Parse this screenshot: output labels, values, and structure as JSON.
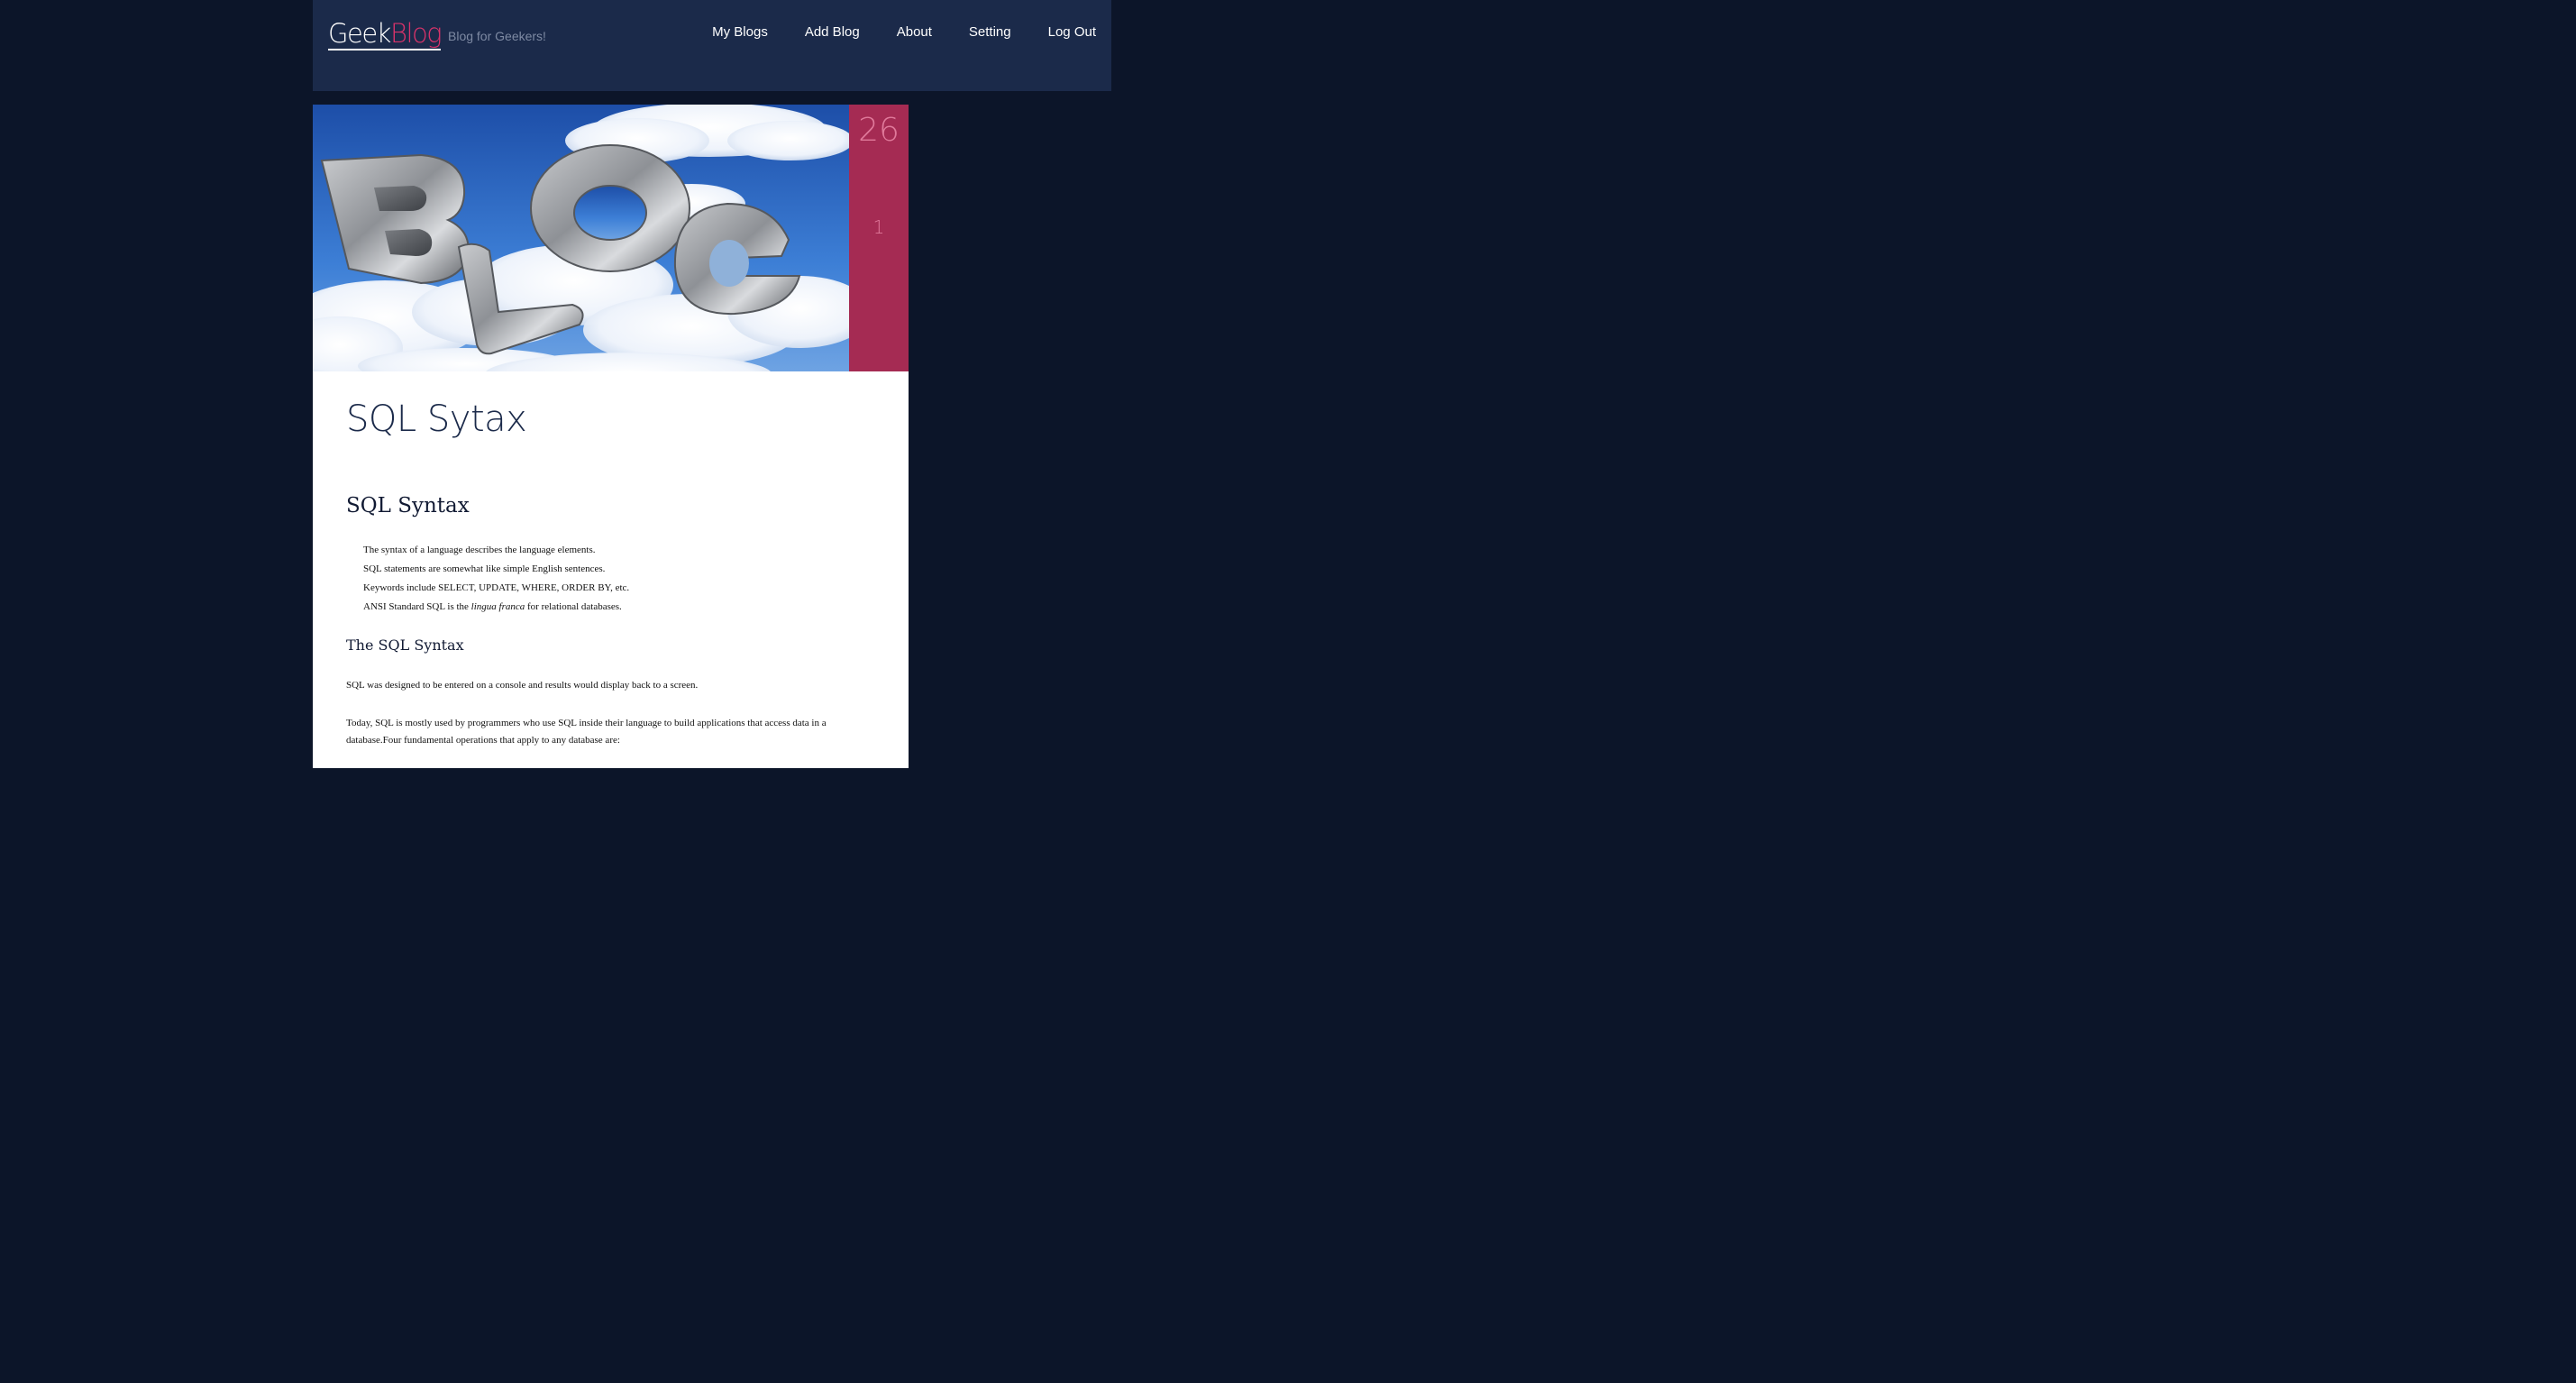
{
  "header": {
    "logo_part1": "Geek",
    "logo_part2": "Blog",
    "tagline": "Blog for Geekers!",
    "nav": [
      "My Blogs",
      "Add Blog",
      "About",
      "Setting",
      "Log Out"
    ]
  },
  "post": {
    "day": "26",
    "month": "1",
    "title": "SQL Sytax",
    "heading": "SQL Syntax",
    "bullets": [
      "The syntax of a language describes the language elements.",
      "SQL statements are somewhat like simple English sentences.",
      "Keywords include SELECT, UPDATE, WHERE, ORDER BY, etc."
    ],
    "bullet4_before": "ANSI Standard SQL is the ",
    "bullet4_italic": "lingua franca",
    "bullet4_after": " for relational databases.",
    "subheading": "The SQL Syntax",
    "para1": "SQL was designed to be entered on a console and results would display back to a screen.",
    "para2": "Today, SQL is mostly used by programmers who use SQL inside their language to build applications that access data in a database.Four fundamental operations that apply to any database are:"
  },
  "colors": {
    "page_bg": "#0c1529",
    "header_bg": "#1b2a4a",
    "accent": "#d8336a",
    "date_bg": "#a52b53"
  },
  "hero_image": "BLOG 3D letters in clouds"
}
